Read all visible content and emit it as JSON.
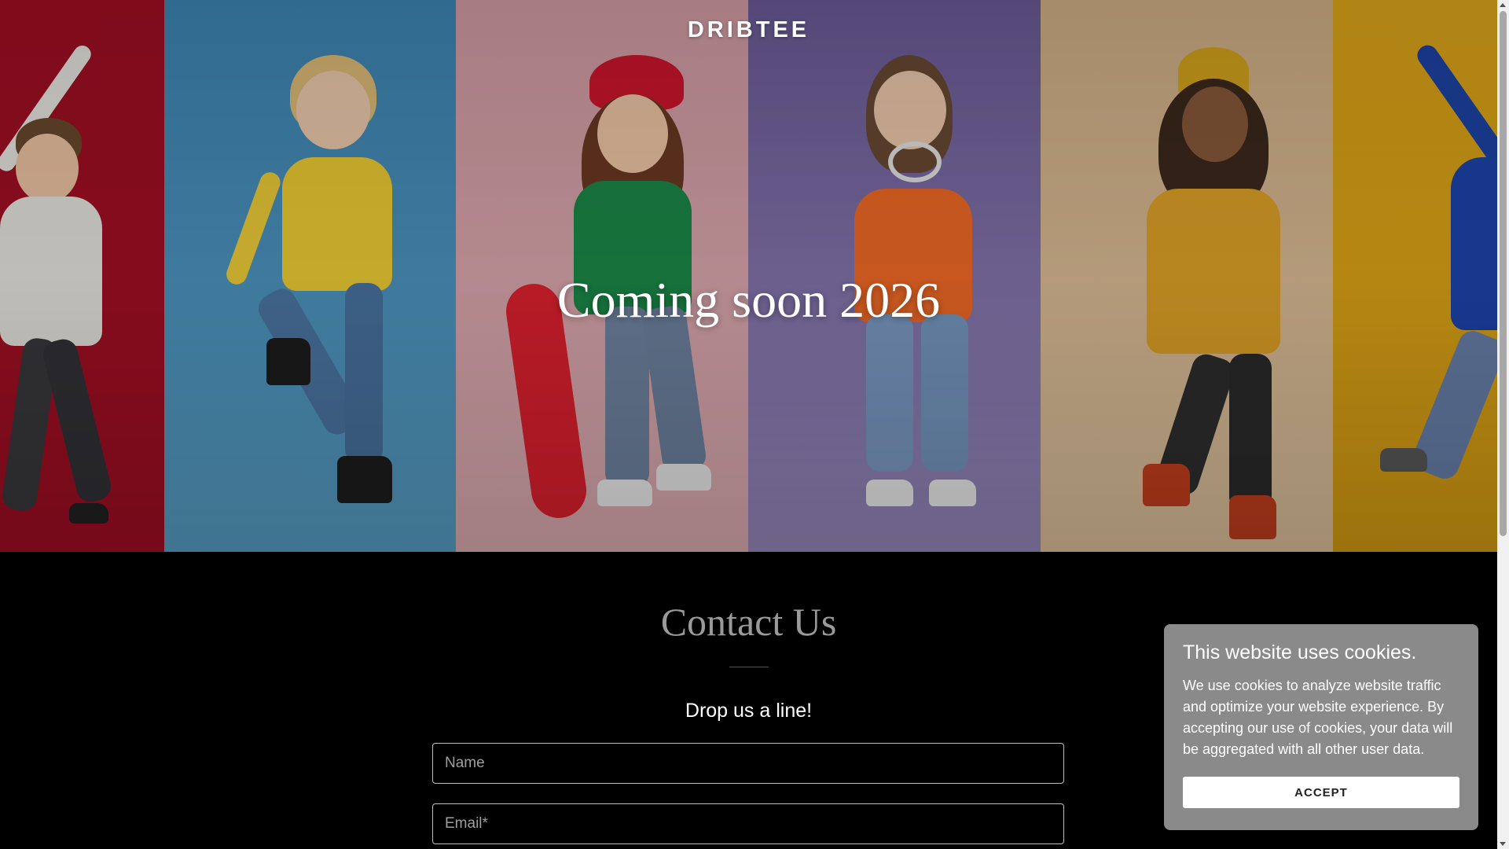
{
  "header": {
    "brand": "DRIBTEE"
  },
  "hero": {
    "title": "Coming soon 2026",
    "panels": [
      {
        "name": "red-panel",
        "color": "#b5122a"
      },
      {
        "name": "blue-panel",
        "color": "#3e86b5"
      },
      {
        "name": "pink-panel",
        "color": "#d59aa3"
      },
      {
        "name": "purple-panel",
        "color": "#7c6aa6"
      },
      {
        "name": "tan-panel",
        "color": "#d8b88e"
      },
      {
        "name": "mustard-panel",
        "color": "#e0a81a"
      }
    ]
  },
  "contact": {
    "title": "Contact Us",
    "subtitle": "Drop us a line!",
    "name_placeholder": "Name",
    "email_placeholder": "Email*"
  },
  "cookie_banner": {
    "title": "This website uses cookies.",
    "text": "We use cookies to analyze website traffic and optimize your website experience. By accepting our use of cookies, your data will be aggregated with all other user data.",
    "accept_label": "ACCEPT",
    "background": "#8a8a8a"
  }
}
